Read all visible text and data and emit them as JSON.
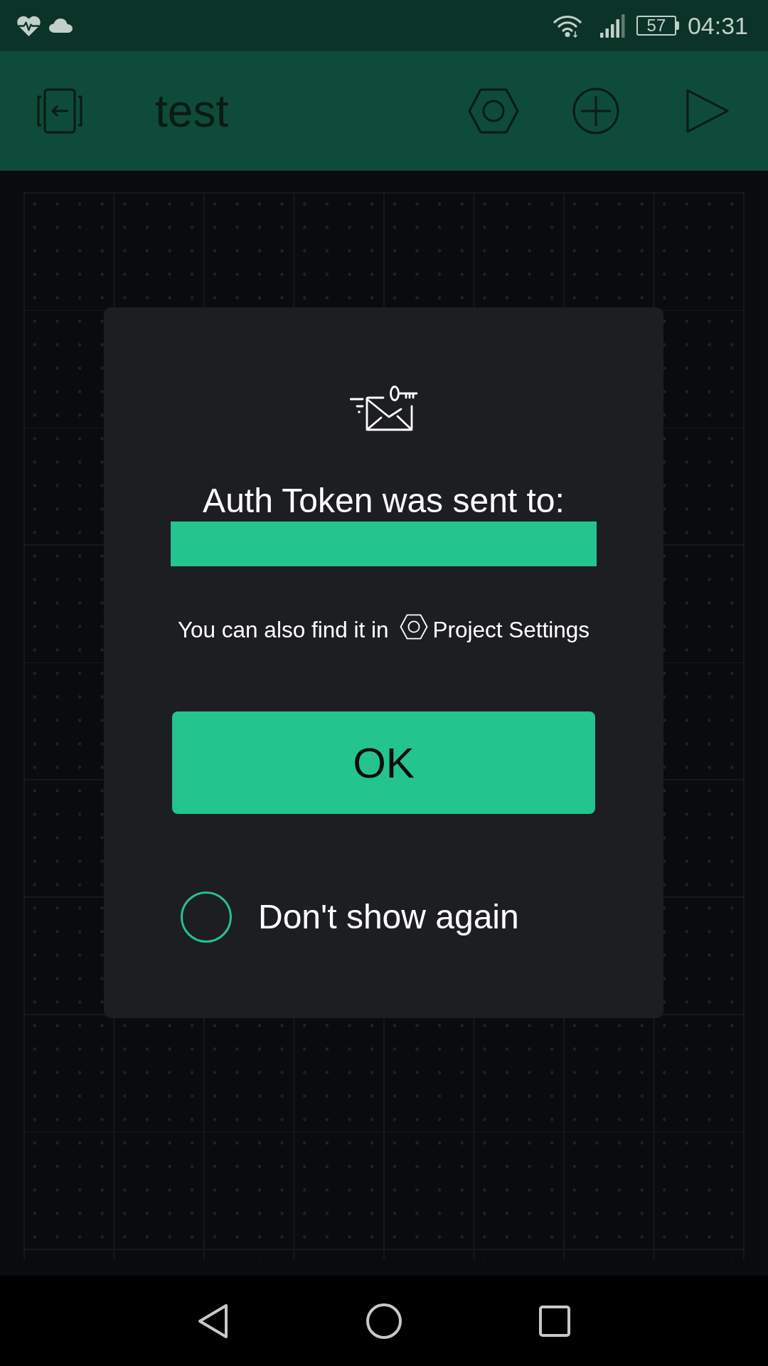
{
  "status_bar": {
    "battery": "57",
    "time": "04:31"
  },
  "toolbar": {
    "title": "test"
  },
  "dialog": {
    "heading": "Auth Token was sent to:",
    "hint": {
      "text": "You can also find it in",
      "target": "Project Settings"
    },
    "button": "OK",
    "checkbox": {
      "label": "Don't show again",
      "checked": false
    }
  }
}
